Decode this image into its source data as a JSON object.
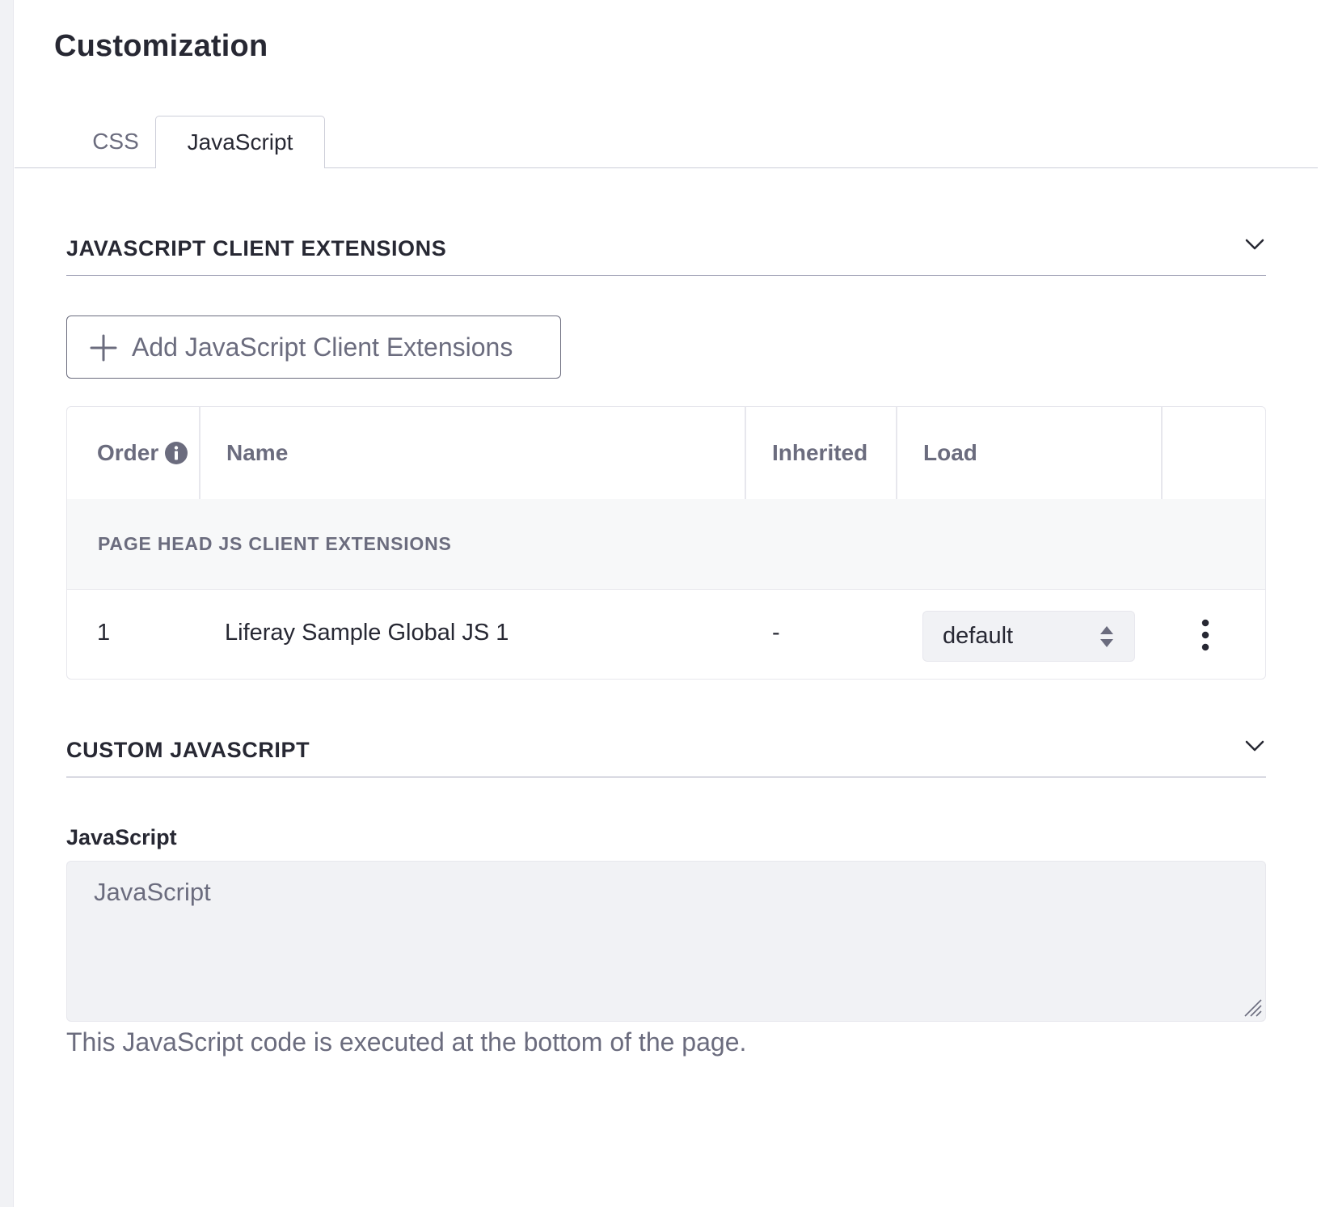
{
  "page": {
    "title": "Customization"
  },
  "tabs": [
    {
      "label": "CSS",
      "active": false
    },
    {
      "label": "JavaScript",
      "active": true
    }
  ],
  "client_extensions": {
    "section_title": "JAVASCRIPT CLIENT EXTENSIONS",
    "add_button_label": "Add JavaScript Client Extensions",
    "table": {
      "headers": {
        "order": "Order",
        "name": "Name",
        "inherited": "Inherited",
        "load": "Load"
      },
      "group_label": "PAGE HEAD JS CLIENT EXTENSIONS",
      "rows": [
        {
          "order": "1",
          "name": "Liferay Sample Global JS 1",
          "inherited": "-",
          "load": "default"
        }
      ]
    }
  },
  "custom_js": {
    "section_title": "CUSTOM JAVASCRIPT",
    "field_label": "JavaScript",
    "placeholder": "JavaScript",
    "value": "",
    "help_text": "This JavaScript code is executed at the bottom of the page."
  },
  "colors": {
    "text_primary": "#272833",
    "text_secondary": "#6b6c7e",
    "border": "#e7e7ed",
    "input_bg": "#f1f2f5",
    "info_icon": "#6b6c7e"
  }
}
